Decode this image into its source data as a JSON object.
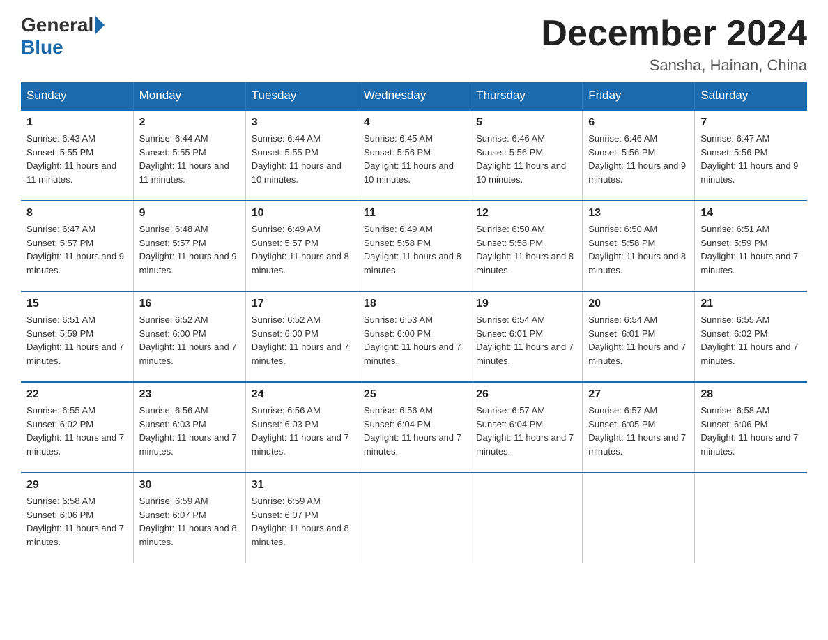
{
  "header": {
    "logo_general": "General",
    "logo_blue": "Blue",
    "month_title": "December 2024",
    "location": "Sansha, Hainan, China"
  },
  "weekdays": [
    "Sunday",
    "Monday",
    "Tuesday",
    "Wednesday",
    "Thursday",
    "Friday",
    "Saturday"
  ],
  "weeks": [
    [
      {
        "day": "1",
        "sunrise": "6:43 AM",
        "sunset": "5:55 PM",
        "daylight": "11 hours and 11 minutes."
      },
      {
        "day": "2",
        "sunrise": "6:44 AM",
        "sunset": "5:55 PM",
        "daylight": "11 hours and 11 minutes."
      },
      {
        "day": "3",
        "sunrise": "6:44 AM",
        "sunset": "5:55 PM",
        "daylight": "11 hours and 10 minutes."
      },
      {
        "day": "4",
        "sunrise": "6:45 AM",
        "sunset": "5:56 PM",
        "daylight": "11 hours and 10 minutes."
      },
      {
        "day": "5",
        "sunrise": "6:46 AM",
        "sunset": "5:56 PM",
        "daylight": "11 hours and 10 minutes."
      },
      {
        "day": "6",
        "sunrise": "6:46 AM",
        "sunset": "5:56 PM",
        "daylight": "11 hours and 9 minutes."
      },
      {
        "day": "7",
        "sunrise": "6:47 AM",
        "sunset": "5:56 PM",
        "daylight": "11 hours and 9 minutes."
      }
    ],
    [
      {
        "day": "8",
        "sunrise": "6:47 AM",
        "sunset": "5:57 PM",
        "daylight": "11 hours and 9 minutes."
      },
      {
        "day": "9",
        "sunrise": "6:48 AM",
        "sunset": "5:57 PM",
        "daylight": "11 hours and 9 minutes."
      },
      {
        "day": "10",
        "sunrise": "6:49 AM",
        "sunset": "5:57 PM",
        "daylight": "11 hours and 8 minutes."
      },
      {
        "day": "11",
        "sunrise": "6:49 AM",
        "sunset": "5:58 PM",
        "daylight": "11 hours and 8 minutes."
      },
      {
        "day": "12",
        "sunrise": "6:50 AM",
        "sunset": "5:58 PM",
        "daylight": "11 hours and 8 minutes."
      },
      {
        "day": "13",
        "sunrise": "6:50 AM",
        "sunset": "5:58 PM",
        "daylight": "11 hours and 8 minutes."
      },
      {
        "day": "14",
        "sunrise": "6:51 AM",
        "sunset": "5:59 PM",
        "daylight": "11 hours and 7 minutes."
      }
    ],
    [
      {
        "day": "15",
        "sunrise": "6:51 AM",
        "sunset": "5:59 PM",
        "daylight": "11 hours and 7 minutes."
      },
      {
        "day": "16",
        "sunrise": "6:52 AM",
        "sunset": "6:00 PM",
        "daylight": "11 hours and 7 minutes."
      },
      {
        "day": "17",
        "sunrise": "6:52 AM",
        "sunset": "6:00 PM",
        "daylight": "11 hours and 7 minutes."
      },
      {
        "day": "18",
        "sunrise": "6:53 AM",
        "sunset": "6:00 PM",
        "daylight": "11 hours and 7 minutes."
      },
      {
        "day": "19",
        "sunrise": "6:54 AM",
        "sunset": "6:01 PM",
        "daylight": "11 hours and 7 minutes."
      },
      {
        "day": "20",
        "sunrise": "6:54 AM",
        "sunset": "6:01 PM",
        "daylight": "11 hours and 7 minutes."
      },
      {
        "day": "21",
        "sunrise": "6:55 AM",
        "sunset": "6:02 PM",
        "daylight": "11 hours and 7 minutes."
      }
    ],
    [
      {
        "day": "22",
        "sunrise": "6:55 AM",
        "sunset": "6:02 PM",
        "daylight": "11 hours and 7 minutes."
      },
      {
        "day": "23",
        "sunrise": "6:56 AM",
        "sunset": "6:03 PM",
        "daylight": "11 hours and 7 minutes."
      },
      {
        "day": "24",
        "sunrise": "6:56 AM",
        "sunset": "6:03 PM",
        "daylight": "11 hours and 7 minutes."
      },
      {
        "day": "25",
        "sunrise": "6:56 AM",
        "sunset": "6:04 PM",
        "daylight": "11 hours and 7 minutes."
      },
      {
        "day": "26",
        "sunrise": "6:57 AM",
        "sunset": "6:04 PM",
        "daylight": "11 hours and 7 minutes."
      },
      {
        "day": "27",
        "sunrise": "6:57 AM",
        "sunset": "6:05 PM",
        "daylight": "11 hours and 7 minutes."
      },
      {
        "day": "28",
        "sunrise": "6:58 AM",
        "sunset": "6:06 PM",
        "daylight": "11 hours and 7 minutes."
      }
    ],
    [
      {
        "day": "29",
        "sunrise": "6:58 AM",
        "sunset": "6:06 PM",
        "daylight": "11 hours and 7 minutes."
      },
      {
        "day": "30",
        "sunrise": "6:59 AM",
        "sunset": "6:07 PM",
        "daylight": "11 hours and 8 minutes."
      },
      {
        "day": "31",
        "sunrise": "6:59 AM",
        "sunset": "6:07 PM",
        "daylight": "11 hours and 8 minutes."
      },
      null,
      null,
      null,
      null
    ]
  ]
}
